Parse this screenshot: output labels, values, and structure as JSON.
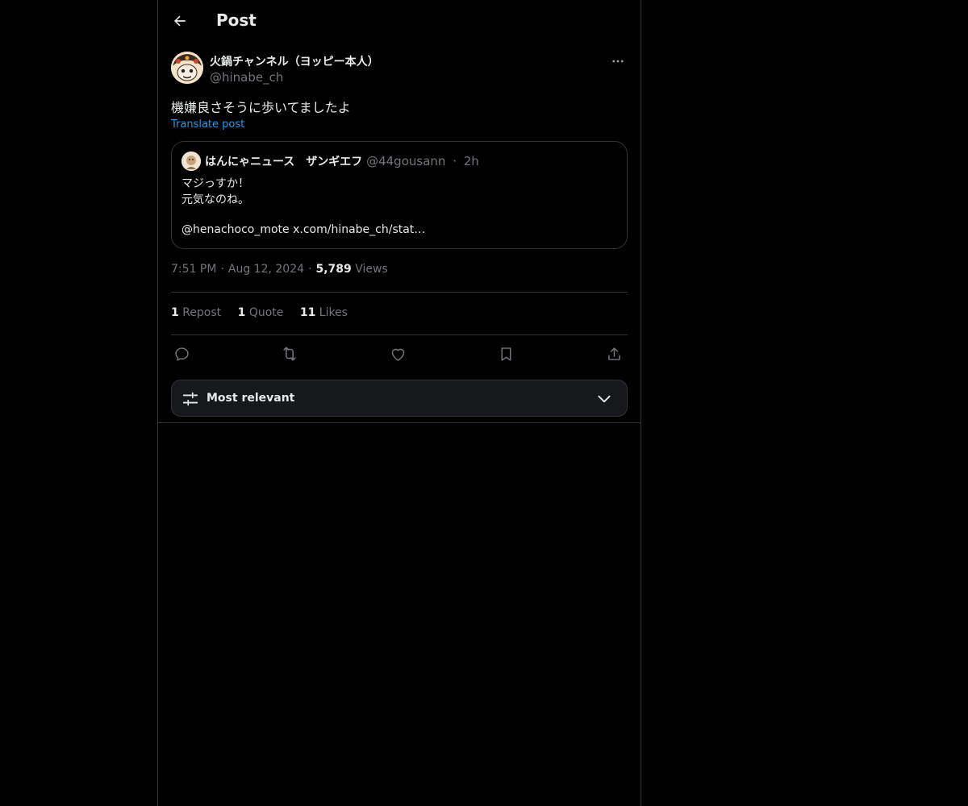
{
  "header": {
    "title": "Post"
  },
  "author": {
    "name": "火鍋チャンネル（ヨッピー本人）",
    "handle": "@hinabe_ch"
  },
  "post": {
    "text": "機嫌良さそうに歩いてましたよ",
    "translate_label": "Translate post"
  },
  "quote": {
    "name": "はんにゃニュース　ザンギエフ",
    "handle": "@44gousann",
    "dot": "·",
    "time": "2h",
    "lines": [
      "マジっすか！",
      "元気なのね。",
      "@henachoco_mote x.com/hinabe_ch/stat…"
    ]
  },
  "meta": {
    "time": "7:51 PM",
    "dot": "·",
    "date": "Aug 12, 2024",
    "views_count": "5,789",
    "views_label": "Views"
  },
  "stats": {
    "reposts_count": "1",
    "reposts_label": "Repost",
    "quotes_count": "1",
    "quotes_label": "Quote",
    "likes_count": "11",
    "likes_label": "Likes"
  },
  "sort": {
    "label": "Most relevant"
  },
  "colors": {
    "accent": "#1d9bf0",
    "text": "#e7e9ea",
    "muted": "#71767b",
    "border": "#2f3336",
    "background": "#000000"
  },
  "icons": [
    "arrow-left-icon",
    "more-icon",
    "reply-icon",
    "repost-icon",
    "like-icon",
    "bookmark-icon",
    "share-icon",
    "sliders-icon",
    "chevron-down-icon"
  ]
}
